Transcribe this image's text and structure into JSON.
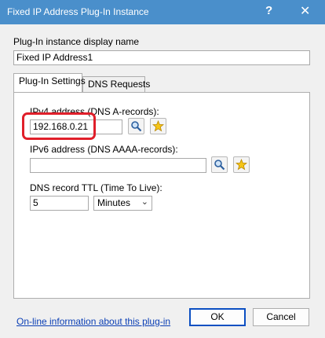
{
  "window": {
    "title": "Fixed IP Address Plug-In Instance",
    "help_glyph": "?",
    "close_glyph": "✕"
  },
  "display_name": {
    "label": "Plug-In instance display name",
    "value": "Fixed IP Address1"
  },
  "tabs": [
    {
      "label": "Plug-In Settings",
      "active": true
    },
    {
      "label": "DNS Requests",
      "active": false
    }
  ],
  "ipv4": {
    "label": "IPv4 address (DNS A-records):",
    "value": "192.168.0.21"
  },
  "ipv6": {
    "label": "IPv6 address (DNS AAAA-records):",
    "value": ""
  },
  "ttl": {
    "label": "DNS record TTL (Time To Live):",
    "value": "5",
    "unit": "Minutes"
  },
  "footer": {
    "link_text": "On-line information about this plug-in",
    "ok_label": "OK",
    "cancel_label": "Cancel"
  },
  "colors": {
    "titlebar": "#4a8fcb",
    "annotation": "#e01f2a",
    "link": "#0b3fb5"
  }
}
